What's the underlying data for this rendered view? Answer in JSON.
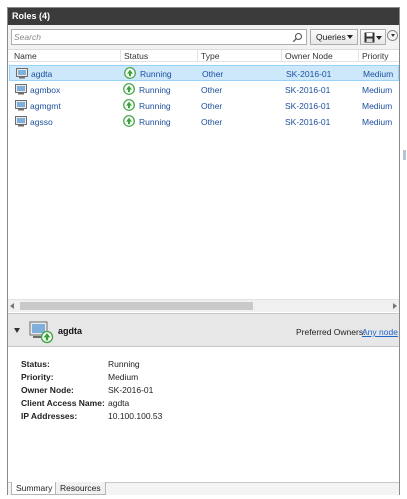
{
  "window": {
    "title": "Roles (4)"
  },
  "toolbar": {
    "search_placeholder": "Search",
    "queries_label": "Queries"
  },
  "grid": {
    "columns": [
      "Name",
      "Status",
      "Type",
      "Owner Node",
      "Priority"
    ],
    "rows": [
      {
        "name": "agdta",
        "status": "Running",
        "type": "Other",
        "owner_node": "SK-2016-01",
        "priority": "Medium",
        "selected": true
      },
      {
        "name": "agmbox",
        "status": "Running",
        "type": "Other",
        "owner_node": "SK-2016-01",
        "priority": "Medium",
        "selected": false
      },
      {
        "name": "agmgmt",
        "status": "Running",
        "type": "Other",
        "owner_node": "SK-2016-01",
        "priority": "Medium",
        "selected": false
      },
      {
        "name": "agsso",
        "status": "Running",
        "type": "Other",
        "owner_node": "SK-2016-01",
        "priority": "Medium",
        "selected": false
      }
    ]
  },
  "details": {
    "name": "agdta",
    "preferred_owners_label": "Preferred Owners:",
    "preferred_owners_link": "Any node",
    "properties": [
      {
        "label": "Status:",
        "value": "Running"
      },
      {
        "label": "Priority:",
        "value": "Medium"
      },
      {
        "label": "Owner Node:",
        "value": "SK-2016-01"
      },
      {
        "label": "Client Access Name:",
        "value": "agdta"
      },
      {
        "label": "IP Addresses:",
        "value": "10.100.100.53"
      }
    ]
  },
  "tabs": [
    {
      "label": "Summary",
      "active": true
    },
    {
      "label": "Resources",
      "active": false
    }
  ],
  "colors": {
    "title_bar": "#3b3b3b",
    "selected_row": "#cde8fb",
    "link": "#2266cc",
    "running_green": "#3aa23a"
  }
}
